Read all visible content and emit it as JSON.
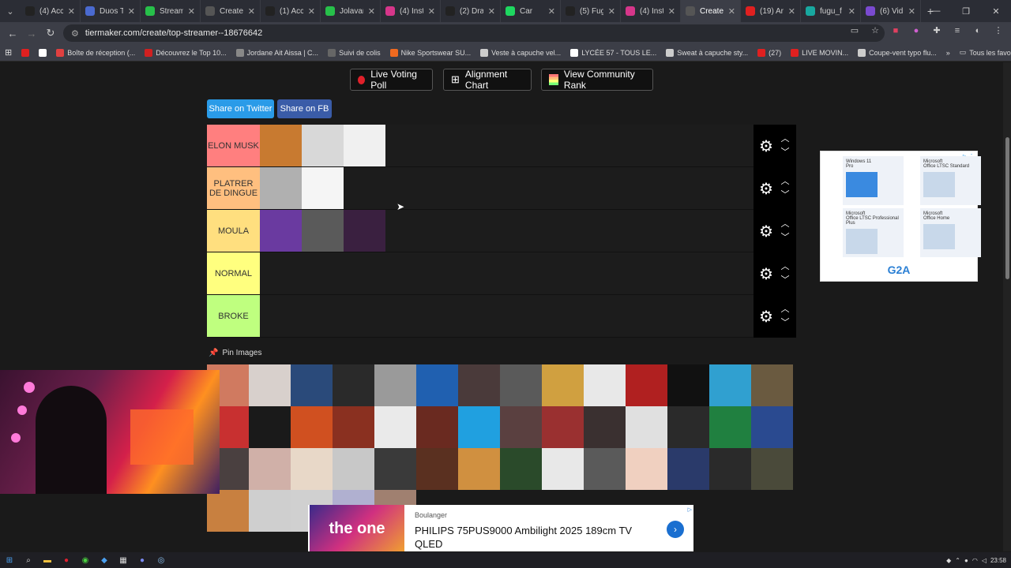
{
  "tabs": [
    {
      "label": "(4) Acc",
      "icon": "x",
      "color": "#222"
    },
    {
      "label": "Duos Ti",
      "icon": "duos",
      "color": "#4a6ad0"
    },
    {
      "label": "Stream",
      "icon": "k",
      "color": "#27c04a"
    },
    {
      "label": "Create",
      "icon": "tiermaker",
      "color": "#555"
    },
    {
      "label": "(1) Acc",
      "icon": "x",
      "color": "#222"
    },
    {
      "label": "Jolavan",
      "icon": "k",
      "color": "#27c04a"
    },
    {
      "label": "(4) Inst",
      "icon": "instagram",
      "color": "#d6368a"
    },
    {
      "label": "(2) Dra",
      "icon": "x",
      "color": "#222"
    },
    {
      "label": "Car",
      "icon": "spotify",
      "color": "#1ed760"
    },
    {
      "label": "(5) Fug",
      "icon": "x",
      "color": "#222"
    },
    {
      "label": "(4) Inst",
      "icon": "instagram",
      "color": "#d6368a"
    },
    {
      "label": "Create",
      "icon": "tiermaker",
      "color": "#555",
      "active": true
    },
    {
      "label": "(19) Ar",
      "icon": "youtube",
      "color": "#e02020"
    },
    {
      "label": "fugu_f",
      "icon": "t",
      "color": "#18a8a0"
    },
    {
      "label": "(6) Vid",
      "icon": "video",
      "color": "#7a4ad0"
    }
  ],
  "url": "tiermaker.com/create/top-streamer--18676642",
  "bookmarks": [
    {
      "label": "",
      "color": "#e02020"
    },
    {
      "label": "",
      "color": "#ffffff"
    },
    {
      "label": "Boîte de réception (...",
      "color": "#e04040"
    },
    {
      "label": "Découvrez le Top 10...",
      "color": "#d02020"
    },
    {
      "label": "Jordane Ait Aissa | C...",
      "color": "#888"
    },
    {
      "label": "Suivi de colis",
      "color": "#666"
    },
    {
      "label": "Nike Sportswear SU...",
      "color": "#f06a20"
    },
    {
      "label": "Veste à capuche vel...",
      "color": "#ccc"
    },
    {
      "label": "LYCÉE 57 - TOUS LE...",
      "color": "#fff"
    },
    {
      "label": "Sweat à capuche sty...",
      "color": "#ccc"
    },
    {
      "label": "(27)",
      "color": "#e02020"
    },
    {
      "label": "LIVE MOVIN...",
      "color": "#e02020"
    },
    {
      "label": "Coupe-vent typo flu...",
      "color": "#ccc"
    }
  ],
  "bookmarks_all": "Tous les favoris",
  "buttons": {
    "live_poll": "Live Voting Poll",
    "alignment": "Alignment Chart",
    "community": "View Community Rank"
  },
  "share": {
    "twitter": "Share on Twitter",
    "fb": "Share on FB"
  },
  "tiers": [
    {
      "label": "ELON MUSK",
      "color": "#ff7f7f",
      "items": [
        "#c87a30",
        "#d8d8d8",
        "#f0f0f0"
      ]
    },
    {
      "label": "PLATRER DE DINGUE",
      "color": "#ffbf7f",
      "items": [
        "#b0b0b0",
        "#f5f5f5"
      ]
    },
    {
      "label": "MOULA",
      "color": "#ffdf7f",
      "items": [
        "#6a3aa0",
        "#5a5a5a",
        "#3a2040"
      ]
    },
    {
      "label": "NORMAL",
      "color": "#ffff7f",
      "items": []
    },
    {
      "label": "BROKE",
      "color": "#bfff7f",
      "items": []
    }
  ],
  "pin_label": "Pin Images",
  "pool": [
    "#d07a60",
    "#d8d0cc",
    "#2a4a7a",
    "#2a2a2a",
    "#9a9a9a",
    "#2060b0",
    "#4a3a3a",
    "#5a5a5a",
    "#d0a040",
    "#e8e8e8",
    "#b02020",
    "#111111",
    "#30a0d0",
    "#6a5a40",
    "#c83030",
    "#1a1a1a",
    "#d05020",
    "#8a3020",
    "#eaeaea",
    "#6a2a20",
    "#20a0e0",
    "#5a4040",
    "#9a3030",
    "#3a3030",
    "#e0e0e0",
    "#2a2a2a",
    "#208040",
    "#2a4a90",
    "#4a4040",
    "#d0b0a8",
    "#e8d8c8",
    "#c8c8c8",
    "#3a3a3a",
    "#5a3020",
    "#d09040",
    "#2a4a2a",
    "#e8e8e8",
    "#5a5a5a",
    "#f0d0c0",
    "#2a3a6a",
    "#2a2a2a",
    "#4a4a3a",
    "#c88040",
    "#cfcfcf",
    "#d0d0d0",
    "#b0b0d0",
    "#a08070"
  ],
  "ad_cells": [
    {
      "title": "Windows 11",
      "sub": "Pro"
    },
    {
      "title": "Microsoft",
      "sub": "Office LTSC Standard"
    },
    {
      "title": "Microsoft",
      "sub": "Office LTSC Professional Plus"
    },
    {
      "title": "Microsoft",
      "sub": "Office Home"
    }
  ],
  "ad_brand": "G2A",
  "banner": {
    "source": "Boulanger",
    "title": "PHILIPS 75PUS9000 Ambilight 2025 189cm TV QLED",
    "image_text": "the one"
  },
  "clock": "23:58"
}
